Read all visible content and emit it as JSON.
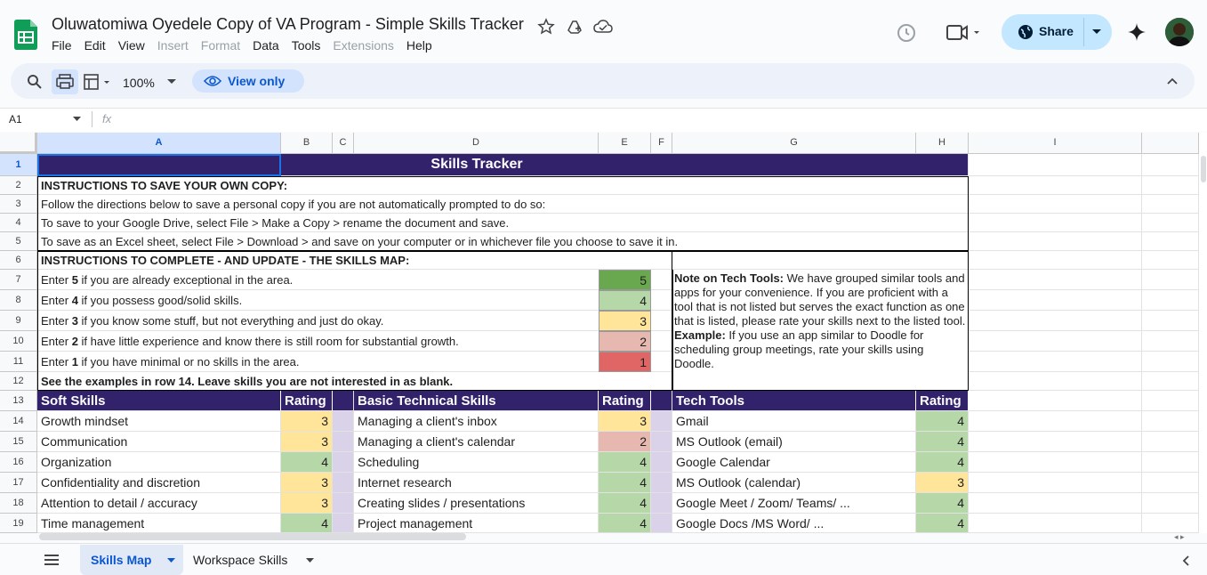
{
  "app": {
    "doc_title": "Oluwatomiwa Oyedele Copy of VA Program - Simple Skills Tracker",
    "menu": [
      {
        "label": "File",
        "enabled": true
      },
      {
        "label": "Edit",
        "enabled": true
      },
      {
        "label": "View",
        "enabled": true
      },
      {
        "label": "Insert",
        "enabled": false
      },
      {
        "label": "Format",
        "enabled": false
      },
      {
        "label": "Data",
        "enabled": true
      },
      {
        "label": "Tools",
        "enabled": true
      },
      {
        "label": "Extensions",
        "enabled": false
      },
      {
        "label": "Help",
        "enabled": true
      }
    ],
    "share_label": "Share",
    "accent_color": "#c2e7ff",
    "brand_color": "#0f9d58"
  },
  "toolbar": {
    "zoom": "100%",
    "view_only_label": "View only"
  },
  "formula_bar": {
    "name_box": "A1",
    "fx_label": "fx"
  },
  "grid": {
    "columns": [
      "A",
      "B",
      "C",
      "D",
      "E",
      "F",
      "G",
      "H",
      "I"
    ],
    "rows": [
      "1",
      "2",
      "3",
      "4",
      "5",
      "6",
      "7",
      "8",
      "9",
      "10",
      "11",
      "12",
      "13",
      "14",
      "15",
      "16",
      "17",
      "18",
      "19"
    ],
    "title": "Skills Tracker",
    "instructions": {
      "save_heading": "INSTRUCTIONS TO SAVE YOUR OWN COPY:",
      "save_line1": "Follow the directions below to save a personal copy if you are not automatically prompted to do so:",
      "save_line2": "To save to your Google Drive, select File > Make a Copy > rename the document and save.",
      "save_line3": "To save as an Excel sheet, select File > Download > and save on your computer or in whichever file you choose to save it in.",
      "complete_heading": "INSTRUCTIONS TO COMPLETE - AND UPDATE - THE SKILLS MAP:",
      "scale": [
        {
          "pre": "Enter ",
          "num": "5",
          "post": " if you are already exceptional in the area.",
          "value": "5"
        },
        {
          "pre": "Enter ",
          "num": "4",
          "post": " if you possess good/solid skills.",
          "value": "4"
        },
        {
          "pre": "Enter ",
          "num": "3",
          "post": " if you know some stuff, but not everything and just do okay.",
          "value": "3"
        },
        {
          "pre": "Enter ",
          "num": "2",
          "post": " if have little experience and know there is still room for substantial growth.",
          "value": "2"
        },
        {
          "pre": "Enter ",
          "num": "1",
          "post": " if you have minimal or no skills in the area.",
          "value": "1"
        }
      ],
      "examples_note": "See the examples in row 14. Leave skills you are not interested in as blank."
    },
    "tech_note": {
      "label": "Note on Tech Tools:",
      "text": " We have grouped similar tools and apps for your convenience. If you are proficient with a tool that is not listed but serves the exact function as one that is listed, please rate your skills next to the listed tool.",
      "example_label": "Example:",
      "example_text": " If you use an app similar to Doodle for scheduling group meetings, rate your skills using Doodle."
    },
    "headers": {
      "soft": "Soft Skills",
      "rating": "Rating",
      "basic": "Basic Technical Skills",
      "tech": "Tech Tools"
    },
    "skills": [
      {
        "soft": "Growth mindset",
        "soft_r": "3",
        "basic": "Managing a client's inbox",
        "basic_r": "3",
        "tech": "Gmail",
        "tech_r": "4"
      },
      {
        "soft": "Communication",
        "soft_r": "3",
        "basic": "Managing a client's calendar",
        "basic_r": "2",
        "tech": "MS Outlook (email)",
        "tech_r": "4"
      },
      {
        "soft": "Organization",
        "soft_r": "4",
        "basic": "Scheduling",
        "basic_r": "4",
        "tech": "Google Calendar",
        "tech_r": "4"
      },
      {
        "soft": "Confidentiality and discretion",
        "soft_r": "3",
        "basic": "Internet research",
        "basic_r": "4",
        "tech": "MS Outlook (calendar)",
        "tech_r": "3"
      },
      {
        "soft": "Attention to detail / accuracy",
        "soft_r": "3",
        "basic": "Creating slides / presentations",
        "basic_r": "4",
        "tech": "Google Meet / Zoom/ Teams/ ...",
        "tech_r": "4"
      },
      {
        "soft": "Time management",
        "soft_r": "4",
        "basic": "Project management",
        "basic_r": "4",
        "tech": "Google Docs /MS Word/ ...",
        "tech_r": "4"
      }
    ]
  },
  "sheet_tabs": [
    {
      "label": "Skills Map",
      "active": true
    },
    {
      "label": "Workspace Skills",
      "active": false
    }
  ]
}
